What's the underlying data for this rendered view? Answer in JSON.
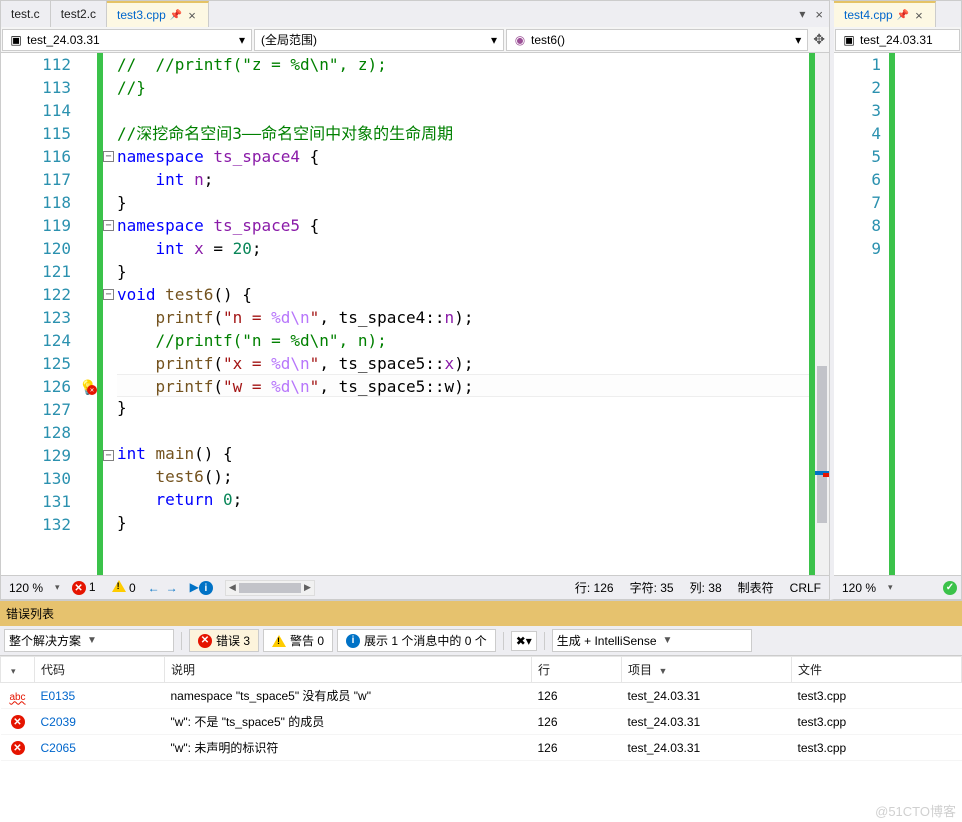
{
  "tabs_left": [
    {
      "label": "test.c",
      "active": false
    },
    {
      "label": "test2.c",
      "active": false
    },
    {
      "label": "test3.cpp",
      "active": true,
      "pinned": true
    }
  ],
  "tabs_right": [
    {
      "label": "test4.cpp",
      "active": true,
      "pinned": true
    }
  ],
  "breadcrumb_left": {
    "scope1": "test_24.03.31",
    "scope2": "(全局范围)",
    "scope3": "test6()"
  },
  "breadcrumb_right": {
    "scope1": "test_24.03.31"
  },
  "code_left": {
    "first_line": 112,
    "lines": [
      {
        "n": 112,
        "html": "<span class='c-comment'>//  //printf(\"z = %d\\n\", z);</span>"
      },
      {
        "n": 113,
        "html": "<span class='c-comment'>//}</span>"
      },
      {
        "n": 114,
        "html": ""
      },
      {
        "n": 115,
        "html": "<span class='c-comment'>//深挖命名空间3——命名空间中对象的生命周期</span>"
      },
      {
        "n": 116,
        "fold": true,
        "html": "<span class='c-keyword'>namespace</span> <span class='c-global'>ts_space4</span> {"
      },
      {
        "n": 117,
        "html": "    <span class='c-keyword'>int</span> <span class='c-global'>n</span>;"
      },
      {
        "n": 118,
        "html": "}"
      },
      {
        "n": 119,
        "fold": true,
        "html": "<span class='c-keyword'>namespace</span> <span class='c-global'>ts_space5</span> {"
      },
      {
        "n": 120,
        "html": "    <span class='c-keyword'>int</span> <span class='c-global'>x</span> = <span class='c-num'>20</span>;"
      },
      {
        "n": 121,
        "html": "}"
      },
      {
        "n": 122,
        "fold": true,
        "html": "<span class='c-keyword'>void</span> <span class='c-func'>test6</span>() {"
      },
      {
        "n": 123,
        "html": "    <span class='c-func'>printf</span>(<span class='c-string'>\"n = </span><span class='c-escape'>%d\\n</span><span class='c-string'>\"</span>, ts_space4::<span class='c-global'>n</span>);"
      },
      {
        "n": 124,
        "html": "    <span class='c-comment'>//printf(\"n = %d\\n\", n);</span>"
      },
      {
        "n": 125,
        "html": "    <span class='c-func'>printf</span>(<span class='c-string'>\"x = </span><span class='c-escape'>%d\\n</span><span class='c-string'>\"</span>, ts_space5::<span class='c-global'>x</span>);"
      },
      {
        "n": 126,
        "hl": true,
        "err": true,
        "html": "    <span class='c-func'>printf</span>(<span class='c-string'>\"w = </span><span class='c-escape'>%d\\n</span><span class='c-string'>\"</span>, ts_space5::<span class='c-err'>w</span>);"
      },
      {
        "n": 127,
        "html": "}"
      },
      {
        "n": 128,
        "html": ""
      },
      {
        "n": 129,
        "fold": true,
        "html": "<span class='c-keyword'>int</span> <span class='c-func'>main</span>() {"
      },
      {
        "n": 130,
        "html": "    <span class='c-func'>test6</span>();"
      },
      {
        "n": 131,
        "html": "    <span class='c-keyword'>return</span> <span class='c-num'>0</span>;"
      },
      {
        "n": 132,
        "html": "}"
      }
    ]
  },
  "code_right": {
    "lines": [
      1,
      2,
      3,
      4,
      5,
      6,
      7,
      8,
      9
    ]
  },
  "status_left": {
    "zoom": "120 %",
    "err_count": "1",
    "warn_count": "0",
    "line": "行: 126",
    "char": "字符: 35",
    "col": "列: 38",
    "tabs": "制表符",
    "crlf": "CRLF"
  },
  "status_right": {
    "zoom": "120 %"
  },
  "errorlist": {
    "title": "错误列表",
    "scope": "整个解决方案",
    "filters": {
      "errors": "错误 3",
      "warnings": "警告 0",
      "messages": "展示 1 个消息中的 0 个"
    },
    "source": "生成 + IntelliSense",
    "columns": {
      "code": "代码",
      "desc": "说明",
      "line": "行",
      "project": "项目",
      "file": "文件"
    },
    "rows": [
      {
        "icon": "abc",
        "code": "E0135",
        "desc": "namespace \"ts_space5\" 没有成员 \"w\"",
        "line": "126",
        "project": "test_24.03.31",
        "file": "test3.cpp"
      },
      {
        "icon": "err",
        "code": "C2039",
        "desc": "\"w\": 不是 \"ts_space5\" 的成员",
        "line": "126",
        "project": "test_24.03.31",
        "file": "test3.cpp"
      },
      {
        "icon": "err",
        "code": "C2065",
        "desc": "\"w\": 未声明的标识符",
        "line": "126",
        "project": "test_24.03.31",
        "file": "test3.cpp"
      }
    ]
  },
  "watermark": "@51CTO博客"
}
